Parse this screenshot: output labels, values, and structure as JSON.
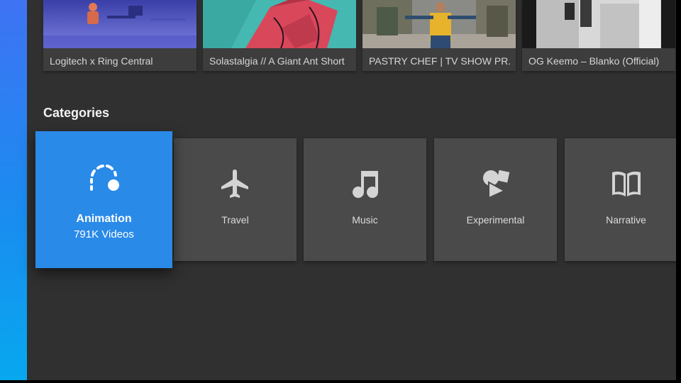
{
  "videos": [
    {
      "title": "Logitech x Ring Central"
    },
    {
      "title": "Solastalgia // A Giant Ant Short"
    },
    {
      "title": "PASTRY CHEF  | TV SHOW PR.."
    },
    {
      "title": "OG Keemo – Blanko (Official)"
    }
  ],
  "categories": {
    "heading": "Categories",
    "items": [
      {
        "label": "Animation",
        "sub": "791K Videos",
        "icon": "animation-icon",
        "selected": true
      },
      {
        "label": "Travel",
        "icon": "airplane-icon"
      },
      {
        "label": "Music",
        "icon": "music-note-icon"
      },
      {
        "label": "Experimental",
        "icon": "shapes-icon"
      },
      {
        "label": "Narrative",
        "icon": "book-icon"
      }
    ]
  },
  "colors": {
    "accent": "#2a8ae8",
    "background": "#303030",
    "tile": "#4a4a4a"
  }
}
